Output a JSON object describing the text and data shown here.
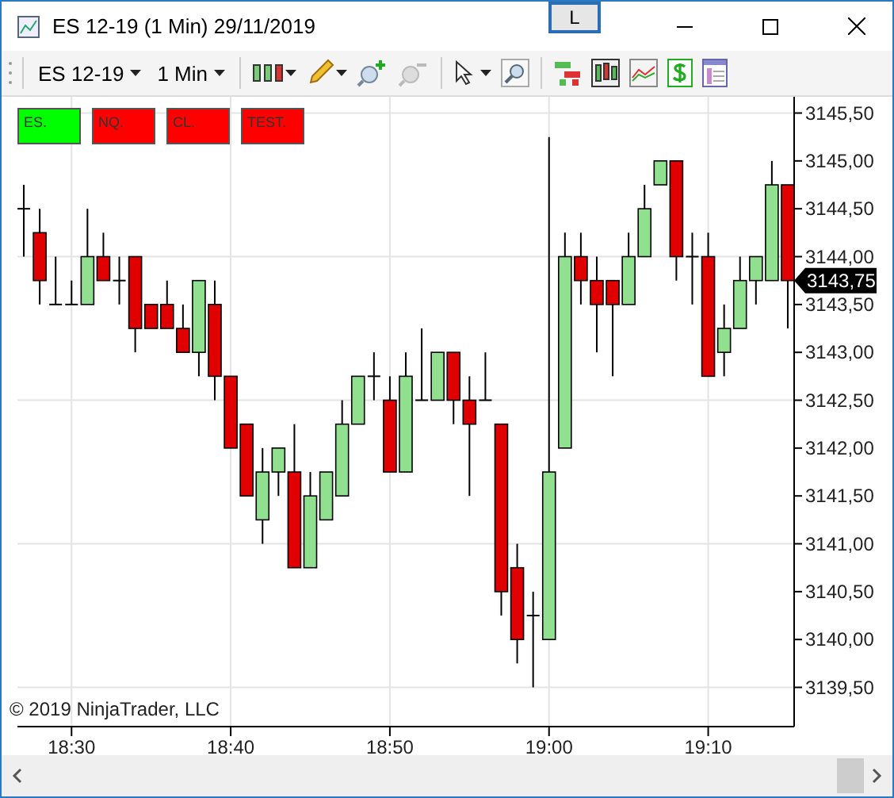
{
  "window": {
    "title": "ES 12-19 (1 Min)  29/11/2019",
    "layout_button": "L"
  },
  "toolbar": {
    "instrument": "ES 12-19",
    "interval": "1 Min"
  },
  "chart": {
    "buttons": [
      {
        "label": "ES.",
        "color": "#00ff00"
      },
      {
        "label": "NQ.",
        "color": "#ff0000"
      },
      {
        "label": "CL.",
        "color": "#ff0000"
      },
      {
        "label": "TEST.",
        "color": "#ff0000"
      }
    ],
    "copyright": "© 2019 NinjaTrader, LLC",
    "price_marker": "3143,75",
    "chart_data": {
      "type": "candlestick",
      "grid": true,
      "ylim": [
        3139.09,
        3145.67
      ],
      "categories": [
        null,
        null,
        null,
        "18:30",
        null,
        null,
        null,
        null,
        null,
        null,
        null,
        null,
        null,
        "18:40",
        null,
        null,
        null,
        null,
        null,
        null,
        null,
        null,
        null,
        "18:50",
        null,
        null,
        null,
        null,
        null,
        null,
        null,
        null,
        null,
        "19:00",
        null,
        null,
        null,
        null,
        null,
        null,
        null,
        null,
        null,
        "19:10",
        null,
        null,
        null,
        null,
        null
      ],
      "yticks": [
        {
          "value": 3145.5,
          "label": "3145,50"
        },
        {
          "value": 3145,
          "label": "3145,00"
        },
        {
          "value": 3144.5,
          "label": "3144,50"
        },
        {
          "value": 3144,
          "label": "3144,00"
        },
        {
          "value": 3143.5,
          "label": "3143,50"
        },
        {
          "value": 3143,
          "label": "3143,00"
        },
        {
          "value": 3142.5,
          "label": "3142,50"
        },
        {
          "value": 3142,
          "label": "3142,00"
        },
        {
          "value": 3141.5,
          "label": "3141,50"
        },
        {
          "value": 3141,
          "label": "3141,00"
        },
        {
          "value": 3140.5,
          "label": "3140,50"
        },
        {
          "value": 3140,
          "label": "3140,00"
        },
        {
          "value": 3139.5,
          "label": "3139,50"
        }
      ],
      "ohlc": [
        [
          3144.5,
          3144.75,
          3144,
          3144.5
        ],
        [
          3144.25,
          3144.5,
          3143.5,
          3143.75
        ],
        [
          3143.5,
          3144,
          3143.5,
          3143.5
        ],
        [
          3143.5,
          3143.75,
          3143.5,
          3143.5
        ],
        [
          3143.5,
          3144.5,
          3143.5,
          3144
        ],
        [
          3144,
          3144.25,
          3143.75,
          3143.75
        ],
        [
          3143.75,
          3144,
          3143.5,
          3143.75
        ],
        [
          3144,
          3144,
          3143,
          3143.25
        ],
        [
          3143.5,
          3143.5,
          3143.25,
          3143.25
        ],
        [
          3143.5,
          3143.75,
          3143.25,
          3143.25
        ],
        [
          3143.25,
          3143.5,
          3143,
          3143
        ],
        [
          3143,
          3143.75,
          3142.75,
          3143.75
        ],
        [
          3143.5,
          3143.75,
          3142.5,
          3142.75
        ],
        [
          3142.75,
          3142.75,
          3142,
          3142
        ],
        [
          3142.25,
          3142.25,
          3141.5,
          3141.5
        ],
        [
          3141.25,
          3142,
          3141,
          3141.75
        ],
        [
          3141.75,
          3142,
          3141.5,
          3142
        ],
        [
          3141.75,
          3142.25,
          3140.75,
          3140.75
        ],
        [
          3140.75,
          3141.75,
          3140.75,
          3141.5
        ],
        [
          3141.25,
          3141.75,
          3141.25,
          3141.75
        ],
        [
          3141.5,
          3142.5,
          3141.5,
          3142.25
        ],
        [
          3142.25,
          3142.75,
          3142.25,
          3142.75
        ],
        [
          3142.75,
          3143,
          3142.5,
          3142.75
        ],
        [
          3142.5,
          3142.75,
          3141.75,
          3141.75
        ],
        [
          3141.75,
          3143,
          3141.75,
          3142.75
        ],
        [
          3142.5,
          3143.25,
          3142.5,
          3142.5
        ],
        [
          3142.5,
          3143,
          3142.5,
          3143
        ],
        [
          3143,
          3143,
          3142.25,
          3142.5
        ],
        [
          3142.5,
          3142.75,
          3141.5,
          3142.25
        ],
        [
          3142.5,
          3143,
          3142.5,
          3142.5
        ],
        [
          3142.25,
          3142.25,
          3140.25,
          3140.5
        ],
        [
          3140.75,
          3141,
          3139.75,
          3140
        ],
        [
          3140.25,
          3140.5,
          3139.5,
          3140.25
        ],
        [
          3140,
          3145.25,
          3140,
          3141.75
        ],
        [
          3142,
          3144.25,
          3142,
          3144
        ],
        [
          3144,
          3144.25,
          3143.5,
          3143.75
        ],
        [
          3143.75,
          3144,
          3143,
          3143.5
        ],
        [
          3143.75,
          3143.75,
          3142.75,
          3143.5
        ],
        [
          3143.5,
          3144.25,
          3143.5,
          3144
        ],
        [
          3144,
          3144.75,
          3144,
          3144.5
        ],
        [
          3144.75,
          3145,
          3144.75,
          3145
        ],
        [
          3145,
          3145,
          3143.75,
          3144
        ],
        [
          3144,
          3144.25,
          3143.5,
          3144
        ],
        [
          3144,
          3144.25,
          3142.75,
          3142.75
        ],
        [
          3143,
          3143.5,
          3142.75,
          3143.25
        ],
        [
          3143.25,
          3144,
          3143.25,
          3143.75
        ],
        [
          3143.75,
          3144,
          3143.5,
          3144
        ],
        [
          3143.75,
          3145,
          3143.75,
          3144.75
        ],
        [
          3144.75,
          3144.75,
          3143.25,
          3143.75
        ]
      ]
    }
  }
}
